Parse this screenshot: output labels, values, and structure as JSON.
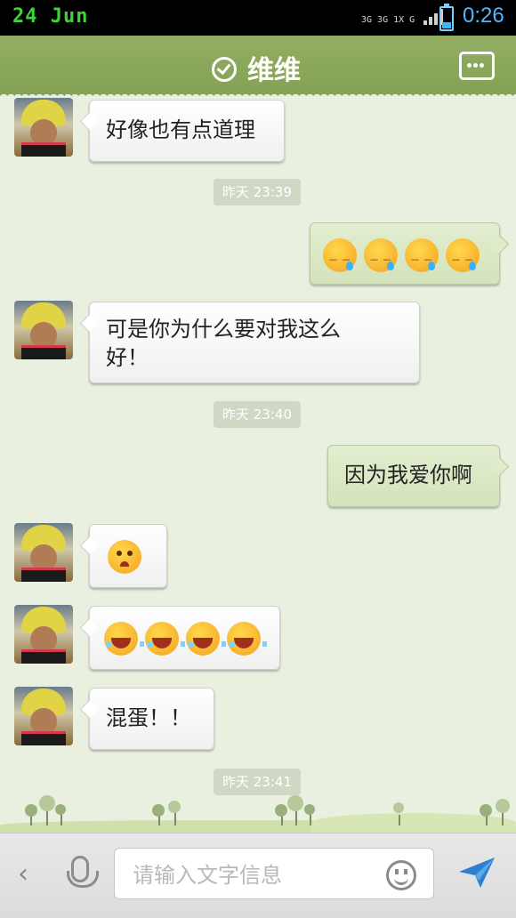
{
  "status_bar": {
    "date": "24 Jun",
    "net_a": "3G",
    "net_b": "3G 1X",
    "net_c": "G",
    "time": "0:26"
  },
  "header": {
    "title": "维维",
    "verified_icon": "check-circle-icon",
    "menu_icon": "more-icon"
  },
  "messages": [
    {
      "side": "left",
      "text": "好像也有点道理"
    },
    {
      "side": "time",
      "text": "昨天 23:39"
    },
    {
      "side": "right",
      "emoji": [
        "sleepy",
        "sleepy",
        "sleepy",
        "sleepy"
      ]
    },
    {
      "side": "left",
      "text_line1": "可是你为什么要对我这么",
      "text_line2": "好！"
    },
    {
      "side": "time",
      "text": "昨天 23:40"
    },
    {
      "side": "right",
      "text": "因为我爱你啊"
    },
    {
      "side": "left",
      "emoji": [
        "cry"
      ]
    },
    {
      "side": "left",
      "emoji": [
        "laugh",
        "laugh",
        "laugh",
        "laugh"
      ]
    },
    {
      "side": "left",
      "text": "混蛋！！"
    },
    {
      "side": "time",
      "text": "昨天 23:41"
    }
  ],
  "input_bar": {
    "placeholder": "请输入文字信息",
    "back_icon": "chevron-left-icon",
    "mic_icon": "microphone-icon",
    "emoji_icon": "smiley-icon",
    "send_icon": "send-icon"
  },
  "colors": {
    "header": "#8aa65a",
    "bg": "#e9f0df",
    "right_bubble": "#d9e8c4",
    "left_bubble": "#ffffff"
  }
}
